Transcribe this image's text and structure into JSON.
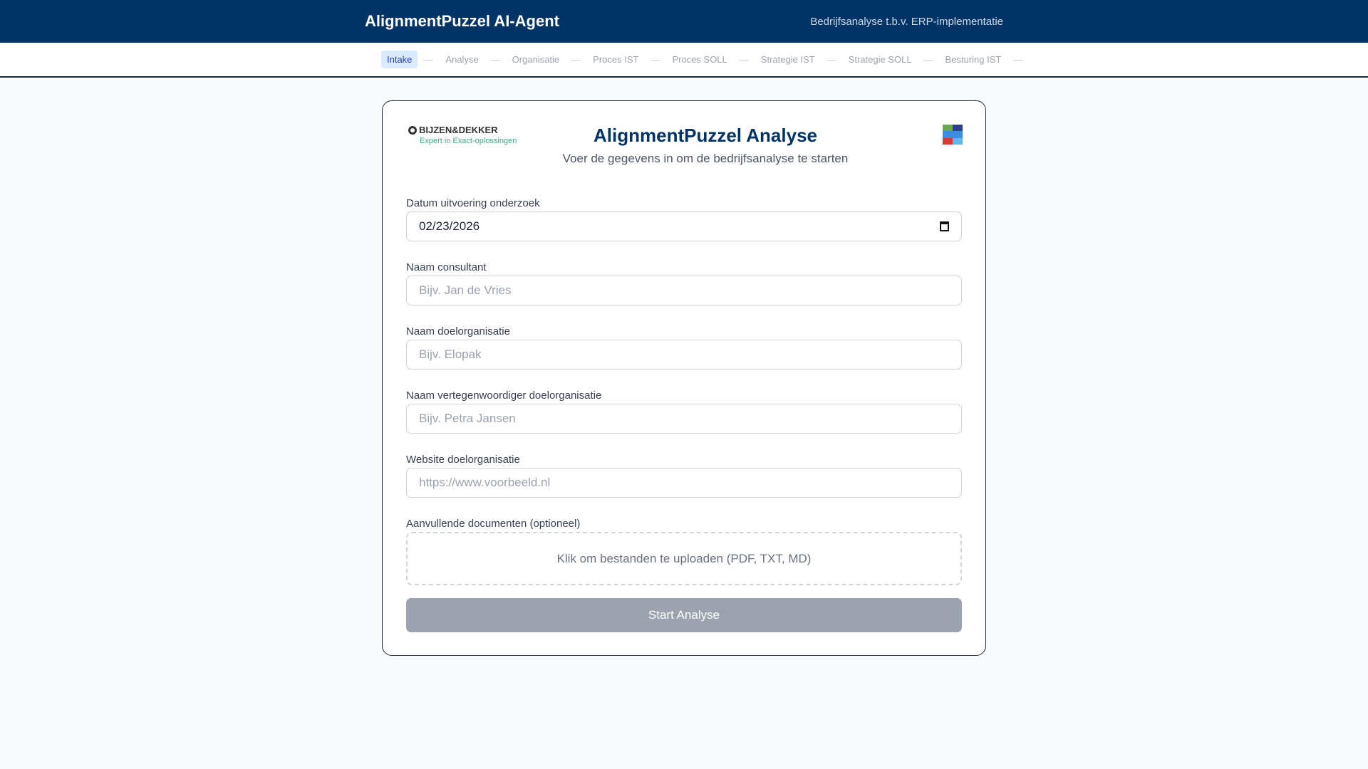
{
  "header": {
    "title": "AlignmentPuzzel AI-Agent",
    "subtitle": "Bedrijfsanalyse t.b.v. ERP-implementatie"
  },
  "steps": [
    "Intake",
    "Analyse",
    "Organisatie",
    "Proces IST",
    "Proces SOLL",
    "Strategie IST",
    "Strategie SOLL",
    "Besturing IST"
  ],
  "card": {
    "logo": {
      "name": "BIJZEN&DEKKER",
      "tagline": "Expert in Exact-oplossingen"
    },
    "title": "AlignmentPuzzel Analyse",
    "subtitle": "Voer de gegevens in om de bedrijfsanalyse te starten",
    "fields": [
      {
        "label": "Datum uitvoering onderzoek",
        "value": "02/23/2026"
      },
      {
        "label": "Naam consultant",
        "placeholder": "Bijv. Jan de Vries"
      },
      {
        "label": "Naam doelorganisatie",
        "placeholder": "Bijv. Elopak"
      },
      {
        "label": "Naam vertegenwoordiger doelorganisatie",
        "placeholder": "Bijv. Petra Jansen"
      },
      {
        "label": "Website doelorganisatie",
        "placeholder": "https://www.voorbeeld.nl"
      }
    ],
    "upload": {
      "label": "Aanvullende documenten (optioneel)",
      "text": "Klik om bestanden te uploaden (PDF, TXT, MD)"
    },
    "submit": "Start Analyse"
  },
  "colors": {
    "brand": "#003366",
    "puzzle": [
      "#6aa84f",
      "#2d3f8f",
      "#3b8ee0",
      "#3b8ee0",
      "#d63b2f",
      "#63b5f0"
    ]
  }
}
